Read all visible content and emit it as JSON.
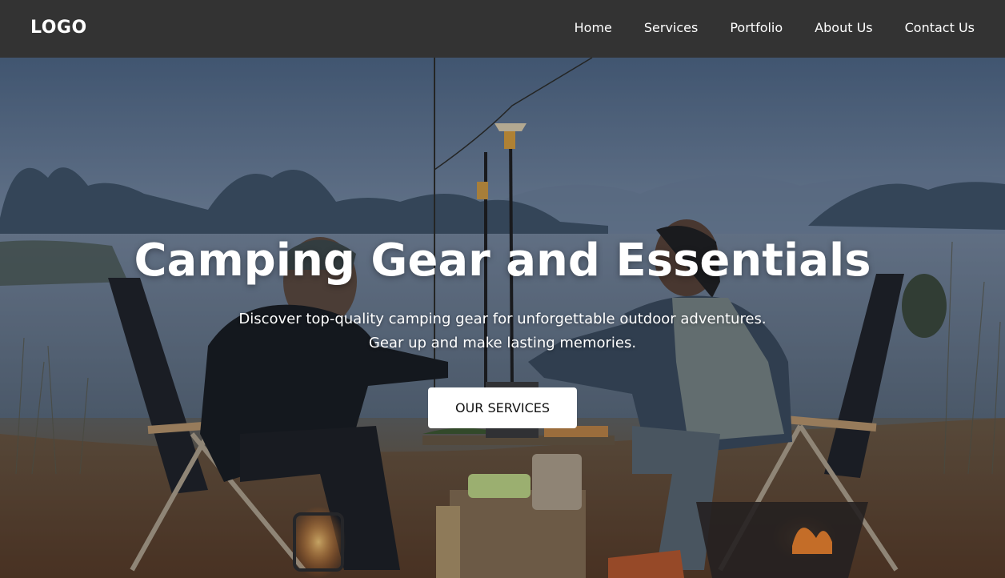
{
  "header": {
    "logo": "LOGO",
    "nav": [
      {
        "label": "Home"
      },
      {
        "label": "Services"
      },
      {
        "label": "Portfolio"
      },
      {
        "label": "About Us"
      },
      {
        "label": "Contact Us"
      }
    ]
  },
  "hero": {
    "title": "Camping Gear and Essentials",
    "subtitle_line1": "Discover top-quality camping gear for unforgettable outdoor adventures.",
    "subtitle_line2": "Gear up and make lasting memories.",
    "cta_label": "OUR SERVICES"
  },
  "colors": {
    "header_bg": "#333333",
    "cta_bg": "#ffffff",
    "text": "#ffffff"
  }
}
